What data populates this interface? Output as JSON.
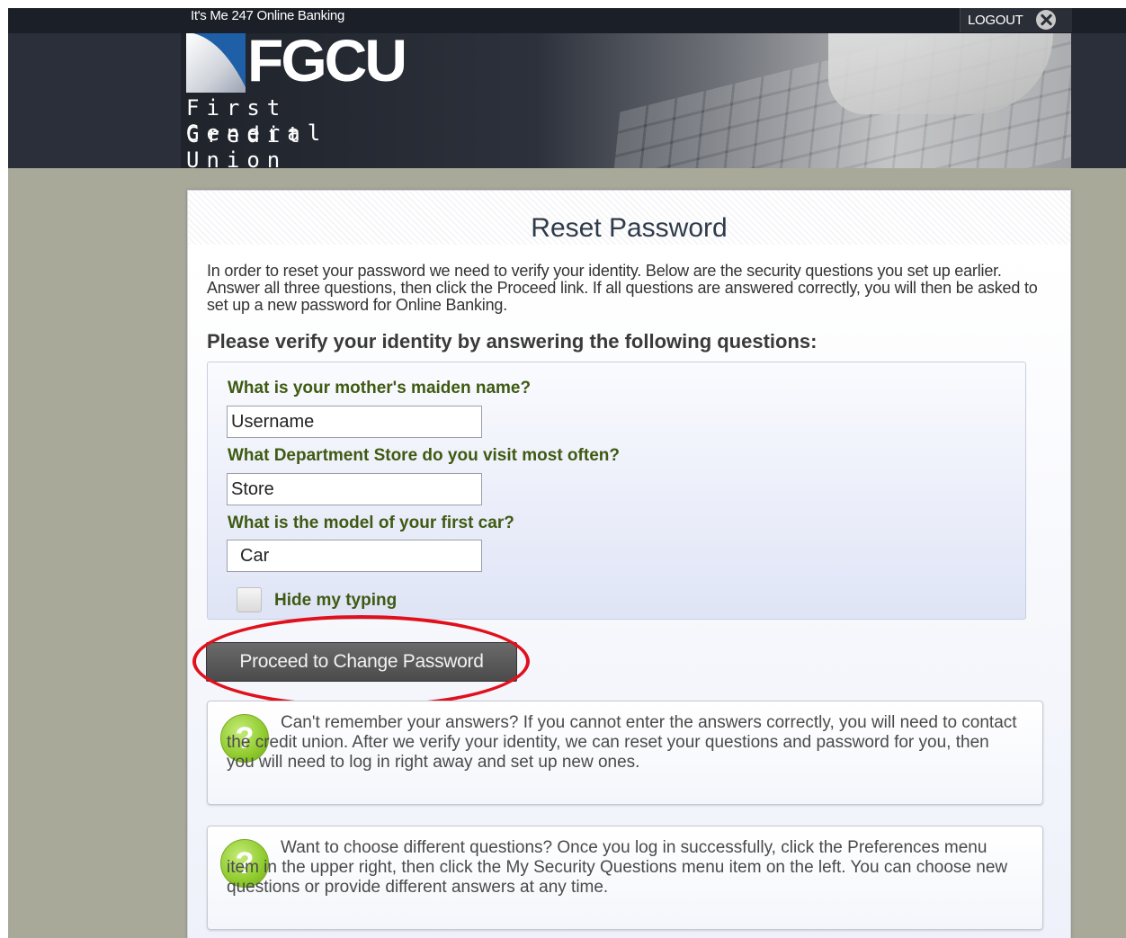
{
  "topbar": {
    "site_name": "It's Me 247 Online Banking",
    "logout_label": "LOGOUT"
  },
  "logo": {
    "wordmark": "FGCU",
    "line1": "First General",
    "line2": "Credit Union"
  },
  "page": {
    "title": "Reset Password",
    "intro": "In order to reset your password we need to verify your identity. Below are the security questions you set up earlier. Answer all three questions, then click the Proceed link. If all questions are answered correctly, you will then be asked to set up a new password for Online Banking.",
    "verify_heading": "Please verify your identity by answering the following questions:"
  },
  "questions": [
    {
      "label": "What is your mother's maiden name?",
      "value": "Username"
    },
    {
      "label": "What Department Store do you visit most often?",
      "value": "Store"
    },
    {
      "label": "What is the model of your first car?",
      "value": "Car"
    }
  ],
  "hide_typing": {
    "label": "Hide my typing",
    "checked": false
  },
  "proceed_button": "Proceed to Change Password",
  "help": [
    {
      "icon": "question-icon",
      "text": "Can't remember your answers? If you cannot enter the answers correctly, you will need to contact the credit union. After we verify your identity, we can reset your questions and password for you, then you will need to log in right away and set up new ones."
    },
    {
      "icon": "question-icon",
      "text": "Want to choose different questions? Once you log in successfully, click the Preferences menu item in the upper right, then click the My Security Questions menu item on the left. You can choose new questions or provide different answers at any time."
    }
  ],
  "colors": {
    "question_label": "#3f5a12",
    "highlight": "#e0101c",
    "header_bg": "#1b1f27",
    "help_icon": "#8fcb2d"
  }
}
